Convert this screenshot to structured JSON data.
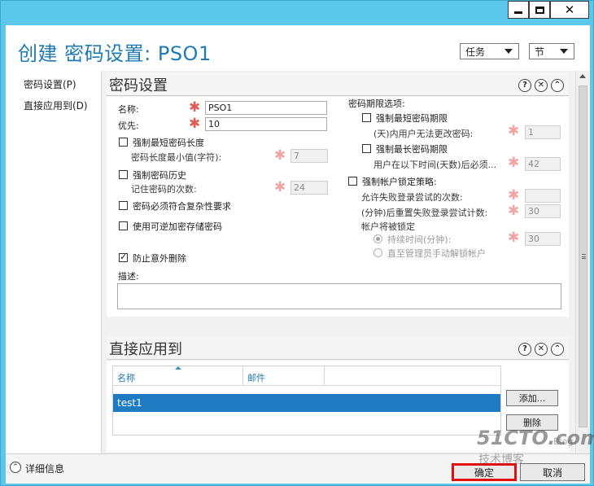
{
  "window": {
    "minimize_icon": "minimize-icon",
    "maximize_icon": "maximize-icon",
    "close_icon": "close-icon",
    "accent_color": "#5bc8eb"
  },
  "header": {
    "title": "创建 密码设置: PSO1",
    "tasks_dropdown": "任务",
    "sections_dropdown": "节"
  },
  "nav": {
    "items": [
      {
        "label": "密码设置(P)"
      },
      {
        "label": "直接应用到(D)"
      }
    ]
  },
  "password_section": {
    "title": "密码设置",
    "help_icon": "?",
    "close_icon": "✕",
    "collapse_icon": "⌃",
    "name_label": "名称:",
    "name_value": "PSO1",
    "precedence_label": "优先:",
    "precedence_value": "10",
    "enforce_min_length": {
      "label": "强制最短密码长度",
      "checked": false
    },
    "min_length_label": "密码长度最小值(字符):",
    "min_length_value": "7",
    "enforce_history": {
      "label": "强制密码历史",
      "checked": false
    },
    "history_label": "记住密码的次数:",
    "history_value": "24",
    "complexity": {
      "label": "密码必须符合复杂性要求",
      "checked": false
    },
    "reversible": {
      "label": "使用可逆加密存储密码",
      "checked": false
    },
    "protect_delete": {
      "label": "防止意外删除",
      "checked": true
    },
    "description_label": "描述:",
    "description_value": "",
    "expiry_title": "密码期限选项:",
    "enforce_min_age": {
      "label": "强制最短密码期限",
      "checked": false
    },
    "min_age_label": "(天)内用户无法更改密码:",
    "min_age_value": "1",
    "enforce_max_age": {
      "label": "强制最长密码期限",
      "checked": false
    },
    "max_age_label": "用户在以下时间(天数)后必须...",
    "max_age_value": "42",
    "lockout": {
      "label": "强制帐户锁定策略:",
      "checked": false
    },
    "failed_attempts_label": "允许失败登录尝试的次数:",
    "failed_attempts_value": "",
    "reset_after_label": "(分钟)后重置失败登录尝试计数:",
    "reset_after_value": "30",
    "lockout_mode_label": "帐户将被锁定",
    "duration_option": {
      "label": "持续时间(分钟):",
      "selected": true
    },
    "duration_value": "30",
    "manual_unlock_option": {
      "label": "直至管理员手动解锁帐户",
      "selected": false
    }
  },
  "apply_section": {
    "title": "直接应用到",
    "help_icon": "?",
    "close_icon": "✕",
    "collapse_icon": "⌃",
    "columns": [
      "名称",
      "邮件"
    ],
    "rows": [
      {
        "name": "test1",
        "mail": ""
      }
    ],
    "add_button": "添加...",
    "remove_button": "删除"
  },
  "footer": {
    "details_label": "详细信息",
    "expander_icon": "⌃",
    "ok_button": "确定",
    "cancel_button": "取消"
  },
  "watermark": {
    "main": "51CTO.com",
    "sub": "技术博客",
    "blog": "Blog"
  }
}
